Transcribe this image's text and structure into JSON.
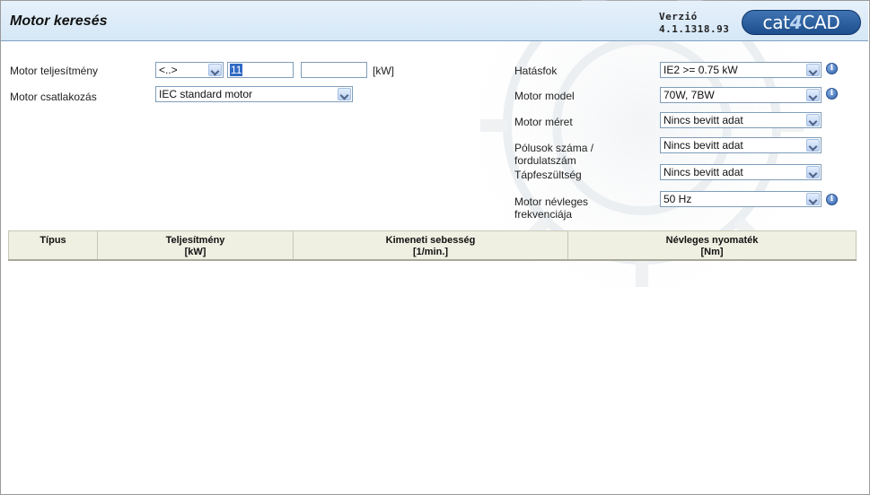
{
  "header": {
    "title": "Motor keresés",
    "version_label": "Verzió",
    "version_number": "4.1.1318.93",
    "logo_prefix": "cat",
    "logo_digit": "4",
    "logo_suffix": "CAD"
  },
  "left_form": {
    "power_label": "Motor teljesítmény",
    "power_operator": "<..>",
    "power_value": "11",
    "power_value_max": "",
    "power_unit": "[kW]",
    "connection_label": "Motor csatlakozás",
    "connection_value": "IEC standard motor"
  },
  "right_form": {
    "efficiency_label": "Hatásfok",
    "efficiency_value": "IE2 >= 0.75 kW",
    "model_label": "Motor model",
    "model_value": "70W, 7BW",
    "size_label": "Motor méret",
    "size_value": "Nincs bevitt adat",
    "poles_label": "Pólusok száma / fordulatszám",
    "poles_value": "Nincs bevitt adat",
    "voltage_label": "Tápfeszültség",
    "voltage_value": "Nincs bevitt adat",
    "frequency_label": "Motor névleges frekvenciája",
    "frequency_value": "50 Hz"
  },
  "results_table": {
    "columns": [
      {
        "title": "Típus",
        "unit": ""
      },
      {
        "title": "Teljesítmény",
        "unit": "[kW]"
      },
      {
        "title": "Kimeneti sebesség",
        "unit": "[1/min.]"
      },
      {
        "title": "Névleges nyomaték",
        "unit": "[Nm]"
      }
    ]
  },
  "icons": {
    "dropdown": "chevron-down-icon",
    "info": "info-icon"
  },
  "colors": {
    "header_bg": "#d5e7f6",
    "logo_bg": "#1d4e8d",
    "table_header_bg": "#efefe2",
    "selection": "#316ac5"
  }
}
